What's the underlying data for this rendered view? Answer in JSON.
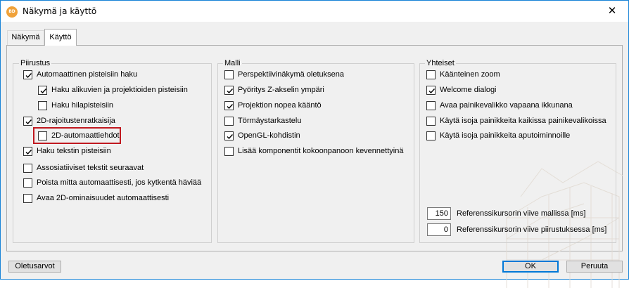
{
  "window": {
    "title": "Näkymä ja käyttö",
    "icon_text": "BD",
    "close_glyph": "✕"
  },
  "tabs": [
    {
      "label": "Näkymä",
      "active": false
    },
    {
      "label": "Käyttö",
      "active": true
    }
  ],
  "groups": {
    "piirustus": {
      "title": "Piirustus",
      "items": [
        {
          "label": "Automaattinen pisteisiin haku",
          "checked": true
        },
        {
          "label": "Haku alikuvien ja projektioiden pisteisiin",
          "checked": true
        },
        {
          "label": "Haku hilapisteisiin",
          "checked": false
        },
        {
          "label": "2D-rajoitustenratkaisija",
          "checked": true
        },
        {
          "label": "2D-automaattiehdot",
          "checked": false
        },
        {
          "label": "Haku tekstin pisteisiin",
          "checked": true
        },
        {
          "label": "Assosiatiiviset tekstit seuraavat",
          "checked": false
        },
        {
          "label": "Poista mitta automaattisesti, jos kytkentä häviää",
          "checked": false
        },
        {
          "label": "Avaa 2D-ominaisuudet automaattisesti",
          "checked": false
        }
      ]
    },
    "malli": {
      "title": "Malli",
      "items": [
        {
          "label": "Perspektiivinäkymä oletuksena",
          "checked": false
        },
        {
          "label": "Pyöritys Z-akselin ympäri",
          "checked": true
        },
        {
          "label": "Projektion nopea kääntö",
          "checked": true
        },
        {
          "label": "Törmäystarkastelu",
          "checked": false
        },
        {
          "label": "OpenGL-kohdistin",
          "checked": true
        },
        {
          "label": "Lisää komponentit kokoonpanoon kevennettyinä",
          "checked": false
        }
      ]
    },
    "yhteiset": {
      "title": "Yhteiset",
      "items": [
        {
          "label": "Käänteinen zoom",
          "checked": false
        },
        {
          "label": "Welcome dialogi",
          "checked": true
        },
        {
          "label": "Avaa painikevalikko vapaana ikkunana",
          "checked": false
        },
        {
          "label": "Käytä isoja painikkeita kaikissa painikevalikoissa",
          "checked": false
        },
        {
          "label": "Käytä isoja painikkeita aputoiminnoille",
          "checked": false
        }
      ],
      "inputs": [
        {
          "value": "150",
          "label": "Referenssikursorin viive mallissa [ms]"
        },
        {
          "value": "0",
          "label": "Referenssikursorin viive piirustuksessa [ms]"
        }
      ]
    }
  },
  "buttons": {
    "defaults": "Oletusarvot",
    "ok": "OK",
    "cancel": "Peruuta"
  }
}
